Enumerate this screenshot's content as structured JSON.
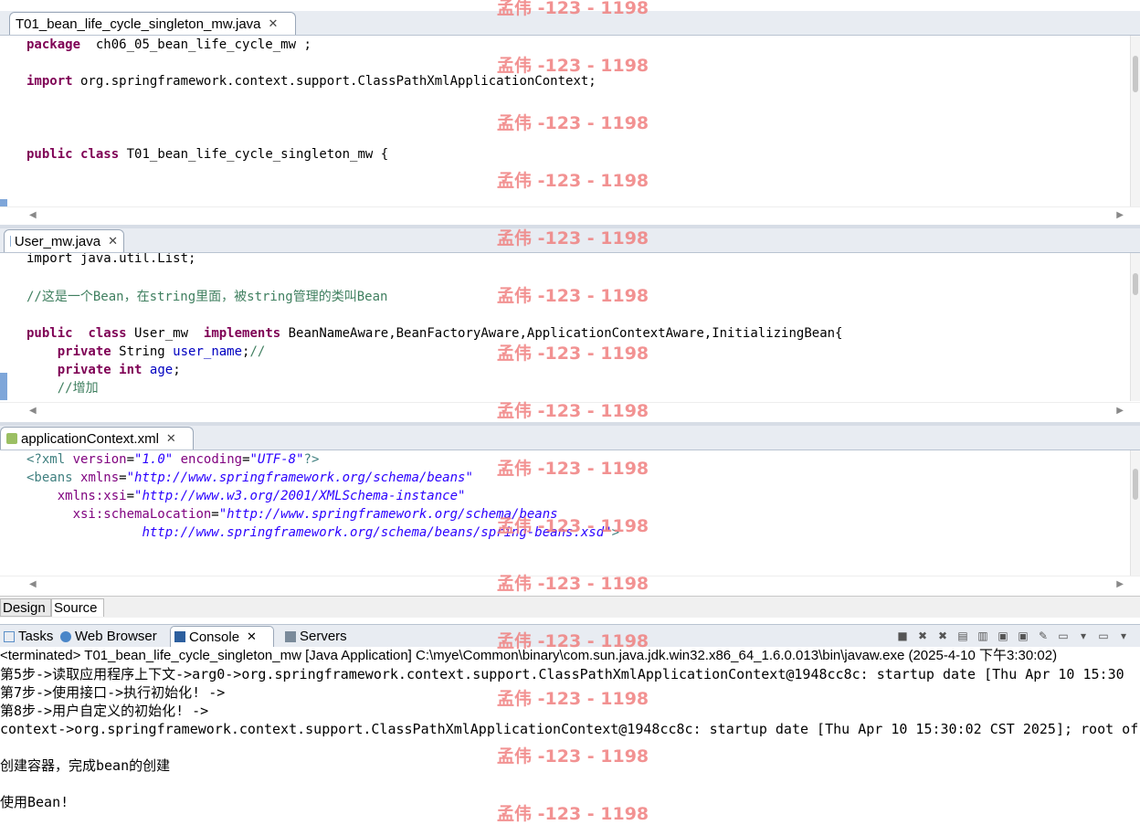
{
  "editor1": {
    "tab_label": "T01_bean_life_cycle_singleton_mw.java",
    "close": "✕",
    "lines": [
      {
        "parts": [
          [
            "kw",
            "package"
          ],
          [
            "",
            "  ch06_05_bean_life_cycle_mw ;"
          ]
        ]
      },
      {
        "parts": [
          [
            "",
            ""
          ]
        ]
      },
      {
        "parts": [
          [
            "kw",
            "import"
          ],
          [
            "",
            " org.springframework.context.support.ClassPathXmlApplicationContext;"
          ]
        ]
      },
      {
        "parts": [
          [
            "",
            ""
          ]
        ]
      },
      {
        "parts": [
          [
            "",
            ""
          ]
        ]
      },
      {
        "parts": [
          [
            "",
            ""
          ]
        ]
      },
      {
        "parts": [
          [
            "kw",
            "public"
          ],
          [
            "",
            " "
          ],
          [
            "kw",
            "class"
          ],
          [
            "",
            " T01_bean_life_cycle_singleton_mw {"
          ]
        ]
      }
    ]
  },
  "editor2": {
    "tab_label": "User_mw.java",
    "close": "✕",
    "top_partial": "import java.util.List;",
    "lines": [
      {
        "parts": [
          [
            "",
            ""
          ]
        ]
      },
      {
        "parts": [
          [
            "cm",
            "//这是一个Bean，在string里面，被string管理的类叫Bean"
          ]
        ]
      },
      {
        "parts": [
          [
            "",
            ""
          ]
        ]
      },
      {
        "parts": [
          [
            "kw",
            "public"
          ],
          [
            "",
            "  "
          ],
          [
            "kw",
            "class"
          ],
          [
            "",
            " User_mw  "
          ],
          [
            "kw",
            "implements"
          ],
          [
            "",
            " BeanNameAware,BeanFactoryAware,ApplicationContextAware,InitializingBean{"
          ]
        ]
      },
      {
        "parts": [
          [
            "",
            "    "
          ],
          [
            "kw",
            "private"
          ],
          [
            "",
            " String "
          ],
          [
            "fld",
            "user_name"
          ],
          [
            "",
            ";"
          ],
          [
            "cm",
            "//"
          ]
        ]
      },
      {
        "parts": [
          [
            "",
            "    "
          ],
          [
            "kw",
            "private"
          ],
          [
            "",
            " "
          ],
          [
            "kw",
            "int"
          ],
          [
            "",
            " "
          ],
          [
            "fld",
            "age"
          ],
          [
            "",
            ";"
          ]
        ]
      },
      {
        "parts": [
          [
            "",
            "    "
          ],
          [
            "cm",
            "//增加"
          ]
        ]
      }
    ]
  },
  "editor3": {
    "tab_label": "applicationContext.xml",
    "close": "✕",
    "lines": [
      {
        "parts": [
          [
            "xmltag",
            "<?xml "
          ],
          [
            "xmlattr",
            "version"
          ],
          [
            "",
            "="
          ],
          [
            "xmlval",
            "\"1.0\""
          ],
          [
            "",
            " "
          ],
          [
            "xmlattr",
            "encoding"
          ],
          [
            "",
            "="
          ],
          [
            "xmlval",
            "\"UTF-8\""
          ],
          [
            "xmltag",
            "?>"
          ]
        ]
      },
      {
        "parts": [
          [
            "xmltag",
            "<beans "
          ],
          [
            "xmlattr",
            "xmlns"
          ],
          [
            "",
            "="
          ],
          [
            "xmlval",
            "\"http://www.springframework.org/schema/beans\""
          ]
        ]
      },
      {
        "parts": [
          [
            "",
            "    "
          ],
          [
            "xmlattr",
            "xmlns:xsi"
          ],
          [
            "",
            "="
          ],
          [
            "xmlval",
            "\"http://www.w3.org/2001/XMLSchema-instance\""
          ]
        ]
      },
      {
        "parts": [
          [
            "",
            "      "
          ],
          [
            "xmlattr",
            "xsi:schemaLocation"
          ],
          [
            "",
            "="
          ],
          [
            "xmlval",
            "\"http://www.springframework.org/schema/beans"
          ]
        ]
      },
      {
        "parts": [
          [
            "",
            "               "
          ],
          [
            "xmlval",
            "http://www.springframework.org/schema/beans/spring-beans.xsd\""
          ],
          [
            "xmltag",
            ">"
          ]
        ]
      }
    ],
    "design_tab": "Design",
    "source_tab": "Source"
  },
  "bottom_panel": {
    "tabs": [
      {
        "label": "Tasks"
      },
      {
        "label": "Web Browser"
      },
      {
        "label": "Console",
        "close": "✕"
      },
      {
        "label": "Servers"
      }
    ],
    "terminated_line": "<terminated> T01_bean_life_cycle_singleton_mw [Java Application] C:\\mye\\Common\\binary\\com.sun.java.jdk.win32.x86_64_1.6.0.013\\bin\\javaw.exe (2025-4-10 下午3:30:02)",
    "output": [
      "第5步->读取应用程序上下文->arg0->org.springframework.context.support.ClassPathXmlApplicationContext@1948cc8c: startup date [Thu Apr 10 15:30",
      "第7步->使用接口->执行初始化! ->",
      "第8步->用户自定义的初始化! ->",
      "context->org.springframework.context.support.ClassPathXmlApplicationContext@1948cc8c: startup date [Thu Apr 10 15:30:02 CST 2025]; root of",
      "",
      "创建容器，完成bean的创建",
      "",
      "使用Bean!"
    ]
  },
  "watermark": "孟伟 -123 - 1198"
}
